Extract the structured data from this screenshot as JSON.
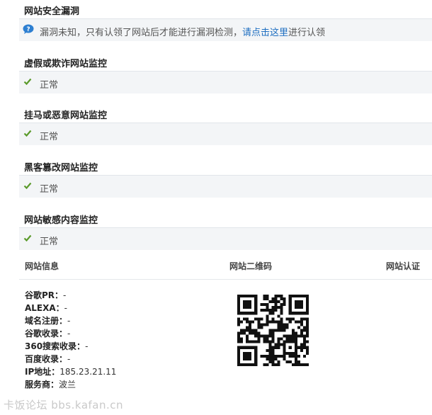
{
  "vuln": {
    "title": "网站安全漏洞",
    "text_before": "漏洞未知，只有认领了网站后才能进行漏洞检测，",
    "link": "请点击这里",
    "text_after": "进行认领"
  },
  "monitors": [
    {
      "title": "虚假或欺诈网站监控",
      "status": "正常"
    },
    {
      "title": "挂马或恶意网站监控",
      "status": "正常"
    },
    {
      "title": "黑客篡改网站监控",
      "status": "正常"
    },
    {
      "title": "网站敏感内容监控",
      "status": "正常"
    }
  ],
  "info_header": {
    "site_info": "网站信息",
    "qr": "网站二维码",
    "cert": "网站认证"
  },
  "site_info": [
    {
      "key": "谷歌PR：",
      "value": "-"
    },
    {
      "key": "ALEXA：",
      "value": "-"
    },
    {
      "key": "域名注册：",
      "value": "-"
    },
    {
      "key": "谷歌收录：",
      "value": "-"
    },
    {
      "key": "360搜索收录：",
      "value": "-"
    },
    {
      "key": "百度收录：",
      "value": "-"
    },
    {
      "key": "IP地址：",
      "value": "185.23.21.11"
    },
    {
      "key": "服务商：",
      "value": "波兰"
    }
  ],
  "watermark": "卡饭论坛 bbs.kafan.cn",
  "colors": {
    "link": "#1f6fc1",
    "check": "#5a9a2a",
    "bar_bg": "#f3f5f7"
  }
}
